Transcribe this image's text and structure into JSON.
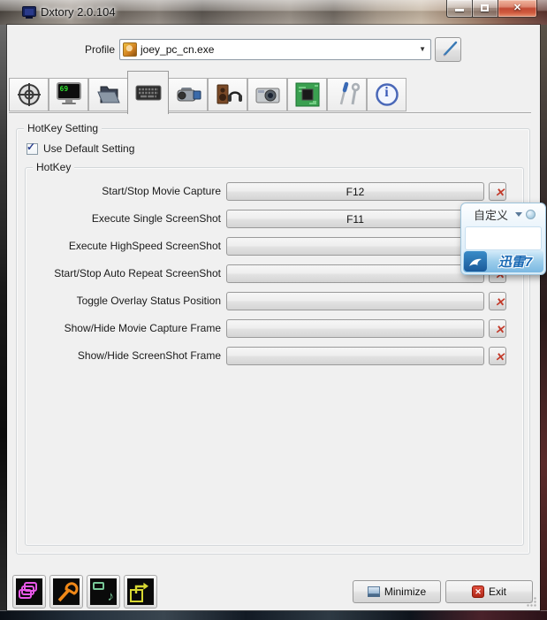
{
  "window": {
    "title": "Dxtory 2.0.104"
  },
  "profile": {
    "label": "Profile",
    "value": "joey_pc_cn.exe"
  },
  "tab_bar": {
    "active_tab": "keyboard",
    "fps_value": "69"
  },
  "hotkey": {
    "section_label": "HotKey Setting",
    "use_default_label": "Use Default Setting",
    "use_default_checked": true,
    "group_label": "HotKey",
    "rows": [
      {
        "label": "Start/Stop Movie Capture",
        "value": "F12"
      },
      {
        "label": "Execute Single ScreenShot",
        "value": "F11"
      },
      {
        "label": "Execute HighSpeed ScreenShot",
        "value": ""
      },
      {
        "label": "Start/Stop Auto Repeat ScreenShot",
        "value": ""
      },
      {
        "label": "Toggle Overlay Status Position",
        "value": ""
      },
      {
        "label": "Show/Hide Movie Capture Frame",
        "value": ""
      },
      {
        "label": "Show/Hide ScreenShot Frame",
        "value": ""
      }
    ]
  },
  "popup": {
    "menu_label": "自定义",
    "brand_label": "迅雷7"
  },
  "footer": {
    "minimize_label": "Minimize",
    "exit_label": "Exit"
  },
  "glyphs": {
    "close_x": "✕",
    "exit_x": "✕",
    "red_x": "✕",
    "checkmark": "✓",
    "dropdown_arrow": "▼",
    "music_note": "♪",
    "info_i": "i"
  },
  "colors": {
    "accent_red": "#c33a2a",
    "xunlei_blue": "#1a6ab5",
    "fps_green": "#30e030"
  }
}
